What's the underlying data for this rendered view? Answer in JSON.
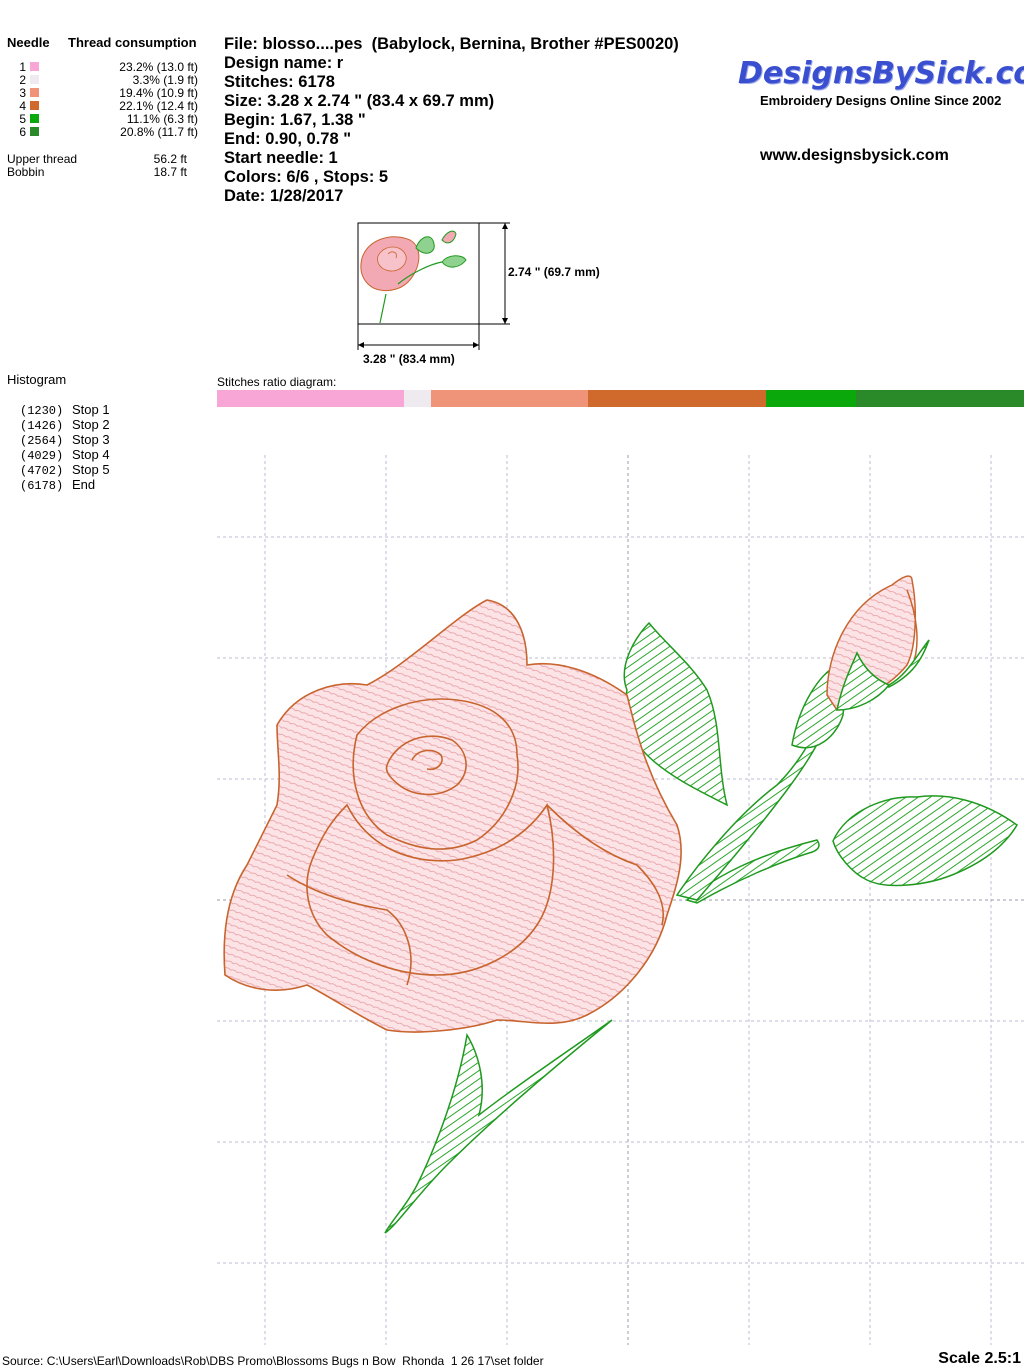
{
  "consumption": {
    "header_needle": "Needle",
    "header_thread": "Thread consumption",
    "needles": [
      {
        "num": "1",
        "color": "#f7a6d6",
        "pct": "23.2% (13.0 ft)"
      },
      {
        "num": "2",
        "color": "#eeeaf0",
        "pct": "3.3% (1.9 ft)"
      },
      {
        "num": "3",
        "color": "#ef9478",
        "pct": "19.4% (10.9 ft)"
      },
      {
        "num": "4",
        "color": "#cf6a2c",
        "pct": "22.1% (12.4 ft)"
      },
      {
        "num": "5",
        "color": "#0aa80a",
        "pct": "11.1% (6.3 ft)"
      },
      {
        "num": "6",
        "color": "#2a8a2a",
        "pct": "20.8% (11.7 ft)"
      }
    ],
    "upper_thread_label": "Upper thread",
    "upper_thread_value": "56.2 ft",
    "bobbin_label": "Bobbin",
    "bobbin_value": "18.7 ft"
  },
  "info": {
    "file": "File: blosso....pes  (Babylock, Bernina, Brother #PES0020)",
    "design_name": "Design name: r",
    "stitches": "Stitches: 6178",
    "size": "Size: 3.28 x 2.74 \" (83.4 x 69.7 mm)",
    "begin": "Begin: 1.67, 1.38 \"",
    "end": "End: 0.90, 0.78 \"",
    "start_needle": "Start needle: 1",
    "colors": "Colors: 6/6 , Stops: 5",
    "date": "Date: 1/28/2017"
  },
  "logo": {
    "title": "DesignsBySick.com",
    "tagline": "Embroidery Designs Online Since 2002",
    "website": "www.designsbysick.com"
  },
  "thumbnail": {
    "height_label": "2.74 \" (69.7 mm)",
    "width_label": "3.28 \" (83.4 mm)"
  },
  "histogram": {
    "title": "Histogram",
    "stops": [
      {
        "count": "(1230)",
        "label": "Stop 1"
      },
      {
        "count": "(1426)",
        "label": "Stop 2"
      },
      {
        "count": "(2564)",
        "label": "Stop 3"
      },
      {
        "count": "(4029)",
        "label": "Stop 4"
      },
      {
        "count": "(4702)",
        "label": "Stop 5"
      },
      {
        "count": "(6178)",
        "label": "End"
      }
    ]
  },
  "ratio": {
    "title": "Stitches ratio diagram:",
    "segments": [
      {
        "color": "#f7a6d6",
        "fraction": 0.232
      },
      {
        "color": "#eeeaf0",
        "fraction": 0.033
      },
      {
        "color": "#ef9478",
        "fraction": 0.194
      },
      {
        "color": "#cf6a2c",
        "fraction": 0.221
      },
      {
        "color": "#0aa80a",
        "fraction": 0.111
      },
      {
        "color": "#2a8a2a",
        "fraction": 0.208
      }
    ]
  },
  "footer": {
    "source": "Source: C:\\Users\\Earl\\Downloads\\Rob\\DBS Promo\\Blossoms Bugs n Bow  Rhonda  1 26 17\\set folder",
    "scale": "Scale 2.5:1"
  },
  "colors": {
    "rose_outline": "#c8642e",
    "rose_fill": "#f3c9cf",
    "stem_green": "#1f9a1f",
    "grid": "#bdbdd6"
  }
}
